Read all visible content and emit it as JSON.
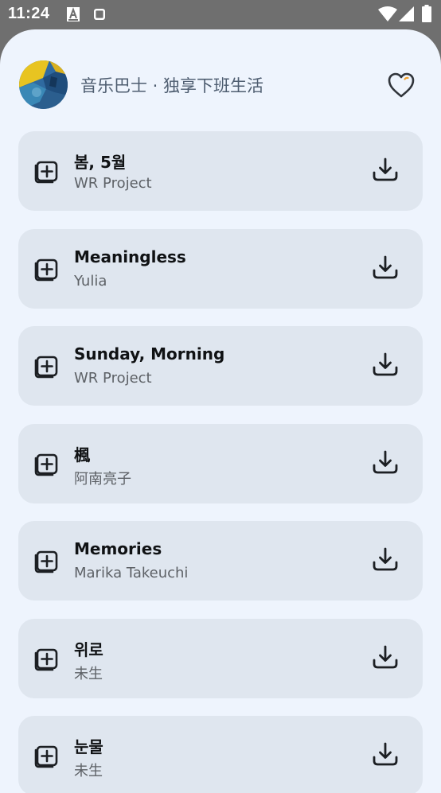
{
  "status_bar": {
    "time": "11:24",
    "icons": [
      "font-a-icon",
      "square-icon",
      "wifi-icon",
      "signal-icon",
      "battery-icon"
    ]
  },
  "header": {
    "title": "音乐巴士 · 独享下班生活",
    "avatar_icon": "album-art-avatar",
    "favorite_icon": "heart-icon"
  },
  "songs": [
    {
      "title": "봄, 5월",
      "artist": "WR Project"
    },
    {
      "title": "Meaningless",
      "artist": "Yulia"
    },
    {
      "title": "Sunday, Morning",
      "artist": "WR Project"
    },
    {
      "title": "楓",
      "artist": "阿南亮子"
    },
    {
      "title": "Memories",
      "artist": "Marika Takeuchi"
    },
    {
      "title": "위로",
      "artist": "未生"
    },
    {
      "title": "눈물",
      "artist": "未生"
    }
  ],
  "colors": {
    "status_bar_bg": "#6f6f6f",
    "sheet_bg": "#eef4fd",
    "card_bg": "#dfe6ef",
    "title_text": "#101214",
    "artist_text": "#5d6166",
    "header_text": "#4e5d70",
    "heart_accent": "#f0a030"
  }
}
